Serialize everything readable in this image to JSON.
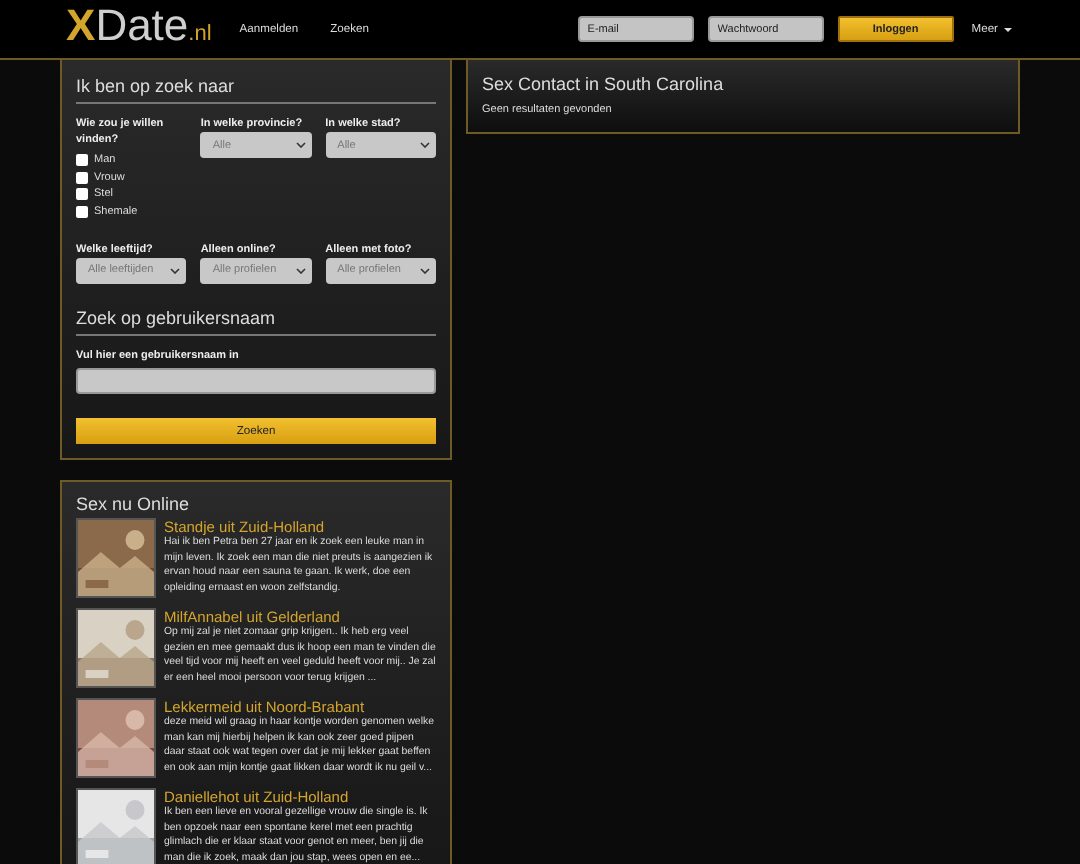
{
  "header": {
    "logo": {
      "mark": "X",
      "name": "Date",
      "suffix": ".nl"
    },
    "nav": [
      "Aanmelden",
      "Zoeken"
    ],
    "email": {
      "placeholder": "E-mail"
    },
    "password": {
      "placeholder": "Wachtwoord"
    },
    "login_button": "Inloggen",
    "more_menu": "Meer"
  },
  "search": {
    "title": "Ik ben op zoek naar",
    "gender": {
      "label": "Wie zou je willen vinden?",
      "options": [
        {
          "label": "Man",
          "checked": false
        },
        {
          "label": "Vrouw",
          "checked": false
        },
        {
          "label": "Stel",
          "checked": false
        },
        {
          "label": "Shemale",
          "checked": false
        }
      ]
    },
    "province": {
      "label": "In welke provincie?",
      "value": "Alle"
    },
    "city": {
      "label": "In welke stad?",
      "value": "Alle"
    },
    "age": {
      "label": "Welke leeftijd?",
      "value": "Alle leeftijden"
    },
    "online": {
      "label": "Alleen online?",
      "value": "Alle profielen"
    },
    "photo": {
      "label": "Alleen met foto?",
      "value": "Alle profielen"
    },
    "username_title": "Zoek op gebruikersnaam",
    "username_label": "Vul hier een gebruikersnaam in",
    "search_button": "Zoeken"
  },
  "results": {
    "title": "Sex Contact in South Carolina",
    "message": "Geen resultaten gevonden"
  },
  "online": {
    "title": "Sex nu Online",
    "profiles": [
      {
        "title": "Standje uit Zuid-Holland",
        "text": "Hai ik ben Petra ben 27 jaar en ik zoek een leuke man in mijn leven. Ik zoek een man die niet preuts is aangezien ik ervan houd naar een sauna te gaan. Ik werk, doe een opleiding ernaast en woon zelfstandig."
      },
      {
        "title": "MilfAnnabel uit Gelderland",
        "text": "Op mij zal je niet zomaar grip krijgen.. Ik heb erg veel gezien en mee gemaakt dus ik hoop een man te vinden die veel tijd voor mij heeft en veel geduld heeft voor mij.. Je zal er een heel mooi persoon voor terug krijgen ..."
      },
      {
        "title": "Lekkermeid uit Noord-Brabant",
        "text": "deze meid wil graag in haar kontje worden genomen welke man kan mij hierbij helpen ik kan ook zeer goed pijpen daar staat ook wat tegen over dat je mij lekker gaat beffen en ook aan mijn kontje gaat likken daar wordt ik nu geil v..."
      },
      {
        "title": "Daniellehot uit Zuid-Holland",
        "text": "Ik ben een lieve en vooral gezellige vrouw die single is. Ik ben opzoek naar een spontane kerel met een prachtig glimlach die er klaar staat voor genot en meer, ben jij die man die ik zoek, maak dan jou stap, wees open en ee..."
      }
    ]
  }
}
